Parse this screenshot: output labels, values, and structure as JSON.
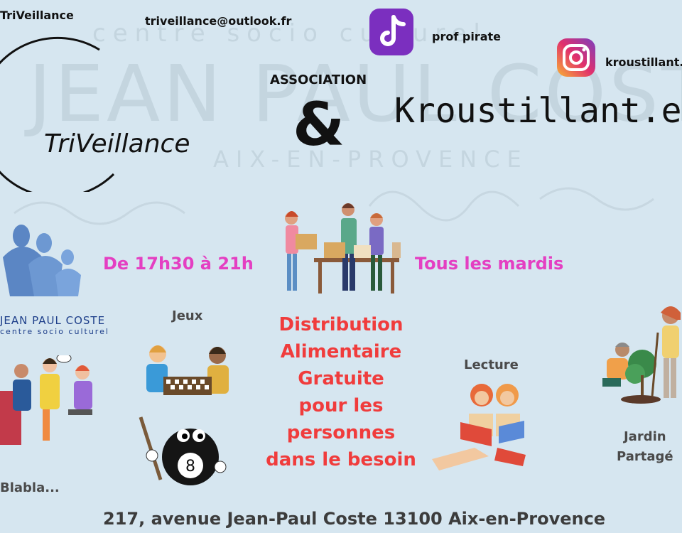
{
  "header": {
    "brand_handle": "TriVeillance",
    "email": "triveillance@outlook.fr",
    "tiktok_handle": "prof pirate",
    "instagram_handle": "kroustillant.e",
    "logo_text": "TriVeillance",
    "association_label": "ASSOCIATION",
    "ampersand": "&",
    "partner_name": "Kroustillant.e",
    "watermark_top": "centre socio culturel",
    "watermark_main": "JEAN PAUL COSTE",
    "watermark_city": "AIX-EN-PROVENCE"
  },
  "schedule": {
    "hours": "De 17h30 à 21h",
    "days": "Tous les mardis"
  },
  "centre_logo": {
    "name": "JEAN PAUL COSTE",
    "subtitle": "centre socio culturel"
  },
  "activities": {
    "games": "Jeux",
    "reading": "Lecture",
    "garden_line1": "Jardin",
    "garden_line2": "Partagé",
    "chat": "Blabla..."
  },
  "main_message": {
    "line1": "Distribution",
    "line2": "Alimentaire",
    "line3": "Gratuite",
    "line4": "pour les",
    "line5": "personnes",
    "line6": "dans le besoin"
  },
  "billiard_number": "8",
  "footer": {
    "address": "217, avenue Jean-Paul Coste 13100 Aix-en-Provence"
  },
  "colors": {
    "background": "#d6e6f0",
    "accent_pink": "#e43fc2",
    "accent_red": "#f03c3c",
    "text_grey": "#4a4a4a"
  }
}
